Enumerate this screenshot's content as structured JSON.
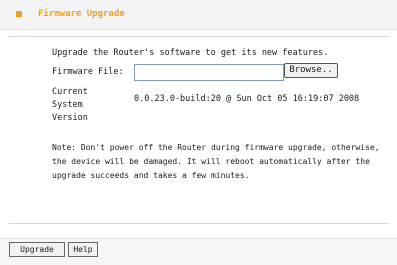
{
  "header": {
    "title": "Firmware Upgrade"
  },
  "main": {
    "intro": "Upgrade the Router's software to get its new features.",
    "firmware_file_label": "Firmware File:",
    "firmware_file_value": "",
    "browse_label": "Browse..",
    "current_version_label": "Current System Version",
    "current_version_value": "0.0.23.0-build:20 @ Sun Oct 05 16:19:07 2008",
    "note": "Note: Don't power off the Router during firmware upgrade, otherwise, the device will be damaged. It will reboot automatically after the upgrade succeeds and takes a few minutes."
  },
  "footer": {
    "upgrade_label": "Upgrade",
    "help_label": "Help"
  },
  "colors": {
    "accent": "#f0a020",
    "panel": "#f4f4f4"
  }
}
